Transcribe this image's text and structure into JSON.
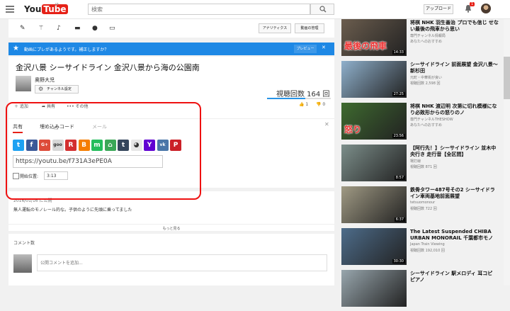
{
  "header": {
    "logo_you": "You",
    "logo_tube": "Tube",
    "logo_region": "JP",
    "search_placeholder": "検索",
    "upload_label": "アップロード",
    "notification_count": "1"
  },
  "toolbar": {
    "analytics_label": "アナリティクス",
    "manage_label": "動画の管理"
  },
  "notice": {
    "text": "動画にプレがあるようです。補正しますか？",
    "preview_label": "プレビュー",
    "close": "✕"
  },
  "video": {
    "title": "金沢八景 シーサイドライン 金沢八景から海の公園南",
    "channel": "奥野大児",
    "channel_settings_label": "チャンネル設定",
    "views": "視聴回数 164 回",
    "add_label": "追加",
    "share_label": "共有",
    "more_label": "その他",
    "likes": "1",
    "dislikes": "0"
  },
  "share": {
    "tabs": [
      "共有",
      "埋め込みコード",
      "メール"
    ],
    "url": "https://youtu.be/f731A3ePE0A",
    "start_label": "開始位置:",
    "start_time": "3:13",
    "icons": [
      {
        "name": "twitter",
        "glyph": "t",
        "color": "#1da1f2"
      },
      {
        "name": "facebook",
        "glyph": "f",
        "color": "#3b5998"
      },
      {
        "name": "google-plus",
        "glyph": "G+",
        "color": "#dd4b39"
      },
      {
        "name": "goo",
        "glyph": "goo",
        "color": "#d7d7d7"
      },
      {
        "name": "reddit",
        "glyph": "R",
        "color": "#d32f2f"
      },
      {
        "name": "blogger",
        "glyph": "B",
        "color": "#f57d00"
      },
      {
        "name": "mixi",
        "glyph": "m",
        "color": "#24bd5c"
      },
      {
        "name": "home",
        "glyph": "⌂",
        "color": "#3aa757"
      },
      {
        "name": "tumblr",
        "glyph": "t",
        "color": "#35465c"
      },
      {
        "name": "reddit-alien",
        "glyph": "◕",
        "color": "#e6e6e6"
      },
      {
        "name": "yahoo",
        "glyph": "Y",
        "color": "#6001d2"
      },
      {
        "name": "vk",
        "glyph": "vk",
        "color": "#4a76a8"
      },
      {
        "name": "pinterest",
        "glyph": "P",
        "color": "#cb2027"
      }
    ]
  },
  "description": {
    "published": "2016/01/16 に公開",
    "text": "無人運転のモノレール的な。子供のように先頭に乗ってました",
    "show_more": "もっと見る"
  },
  "comments": {
    "count_label": "コメント数",
    "placeholder": "公開コメントを追加..."
  },
  "related": [
    {
      "title": "将棋 NHK 羽生善治 プロでも信じ せない最後の飛車から思い",
      "channel": "専門チャンネル情報局",
      "views": "あなたへのおすすめ",
      "duration": "14:33",
      "thumb": "#6b5d4e",
      "label": "最後の飛車"
    },
    {
      "title": "シーサイドライン 前面展望 金沢八景〜新杉田",
      "channel": "元町・中華街が良い",
      "views": "視聴回数 2,598 回",
      "duration": "27:25",
      "thumb": "#8fb0cc",
      "label": ""
    },
    {
      "title": "将棋 NHK 渡辺明 次第に切れ模様になり必敗形からの怒りのノ",
      "channel": "専門チャンネルTHESHOW",
      "views": "あなたへのおすすめ",
      "duration": "23:56",
      "thumb": "#3e6a2f",
      "label": "怒り"
    },
    {
      "title": "【阿行先！】シーサイドライン 並木中央行き 走行音【全区間】",
      "channel": "場打線",
      "views": "視聴回数 871 回",
      "duration": "8:57",
      "thumb": "#7c8e8a",
      "label": ""
    },
    {
      "title": "鉄骨タワー487号その2 シーサイドライン車両基地前面展望",
      "channel": "tetsuomonour",
      "views": "視聴回数 722 回",
      "duration": "6:37",
      "thumb": "#a09a84",
      "label": ""
    },
    {
      "title": "The Latest Suspended CHIBA URBAN MONORAIL 千葉都市モノ",
      "channel": "Japan Train Viewing",
      "views": "視聴回数 192,010 回",
      "duration": "30:30",
      "thumb": "#4d6c8a",
      "label": ""
    },
    {
      "title": "シーサイドライン 駅メロディ 耳コピ ピアノ",
      "channel": "",
      "views": "",
      "duration": "",
      "thumb": "#98a6ad",
      "label": ""
    }
  ]
}
